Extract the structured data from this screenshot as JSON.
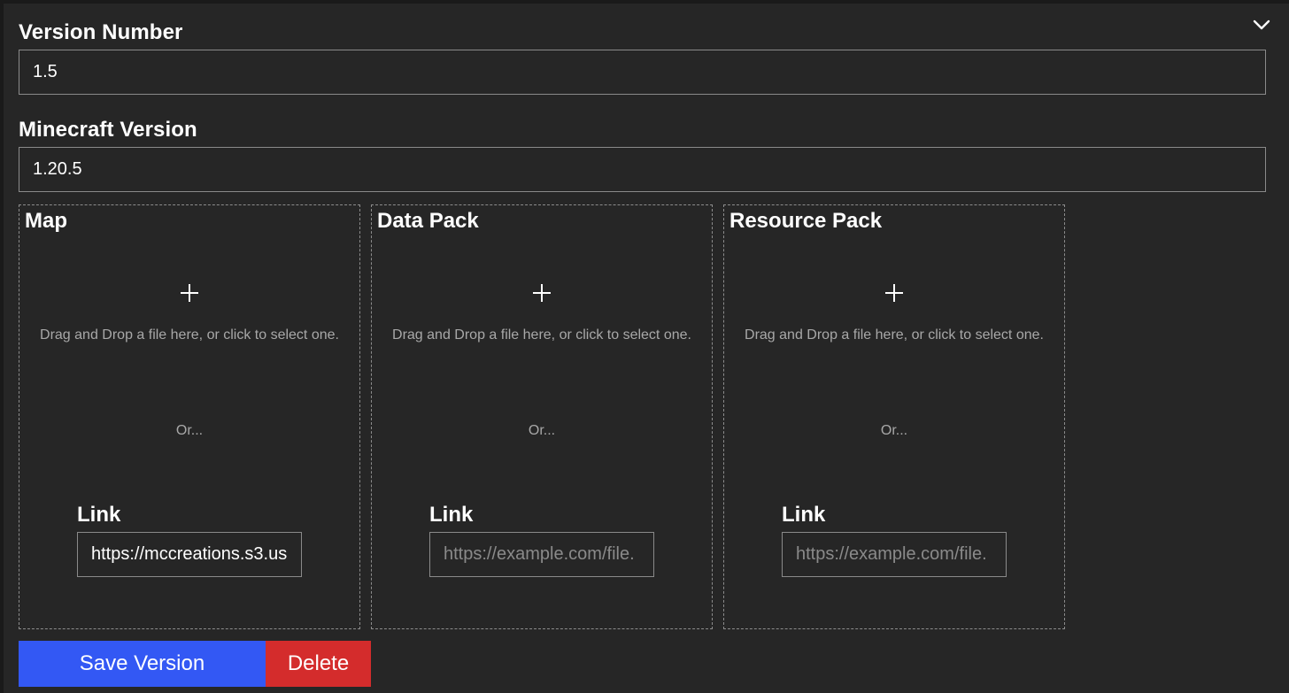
{
  "form": {
    "version_number": {
      "label": "Version Number",
      "value": "1.5"
    },
    "minecraft_version": {
      "label": "Minecraft Version",
      "value": "1.20.5"
    }
  },
  "dropzones": [
    {
      "title": "Map",
      "help_text": "Drag and Drop a file here, or click to select one.",
      "or_text": "Or...",
      "link_label": "Link",
      "link_value": "https://mccreations.s3.us",
      "link_placeholder": "https://example.com/file."
    },
    {
      "title": "Data Pack",
      "help_text": "Drag and Drop a file here, or click to select one.",
      "or_text": "Or...",
      "link_label": "Link",
      "link_value": "",
      "link_placeholder": "https://example.com/file."
    },
    {
      "title": "Resource Pack",
      "help_text": "Drag and Drop a file here, or click to select one.",
      "or_text": "Or...",
      "link_label": "Link",
      "link_value": "",
      "link_placeholder": "https://example.com/file."
    }
  ],
  "actions": {
    "save_label": "Save Version",
    "delete_label": "Delete"
  },
  "colors": {
    "panel_bg": "#262626",
    "save_button": "#3358f4",
    "delete_button": "#d42c2c"
  },
  "icons": {
    "collapse": "chevron-down-icon",
    "add_file": "plus-icon"
  }
}
